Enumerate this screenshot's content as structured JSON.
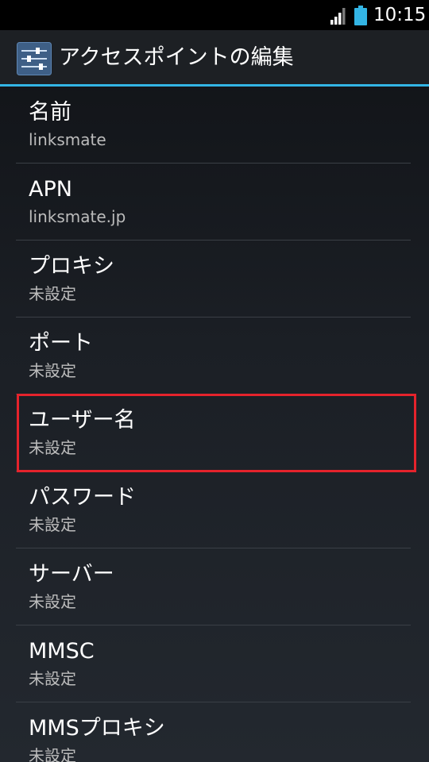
{
  "status_bar": {
    "time": "10:15",
    "signal_icon": "cell-signal-icon",
    "battery_icon": "battery-icon",
    "battery_color": "#33b5e5"
  },
  "action_bar": {
    "icon": "settings-sliders-icon",
    "title": "アクセスポイントの編集",
    "accent_color": "#33b5e5"
  },
  "preferences": [
    {
      "title": "名前",
      "summary": "linksmate"
    },
    {
      "title": "APN",
      "summary": "linksmate.jp"
    },
    {
      "title": "プロキシ",
      "summary": "未設定"
    },
    {
      "title": "ポート",
      "summary": "未設定"
    },
    {
      "title": "ユーザー名",
      "summary": "未設定",
      "highlighted": true
    },
    {
      "title": "パスワード",
      "summary": "未設定"
    },
    {
      "title": "サーバー",
      "summary": "未設定"
    },
    {
      "title": "MMSC",
      "summary": "未設定"
    },
    {
      "title": "MMSプロキシ",
      "summary": "未設定"
    }
  ],
  "highlight_color": "#e5232c"
}
